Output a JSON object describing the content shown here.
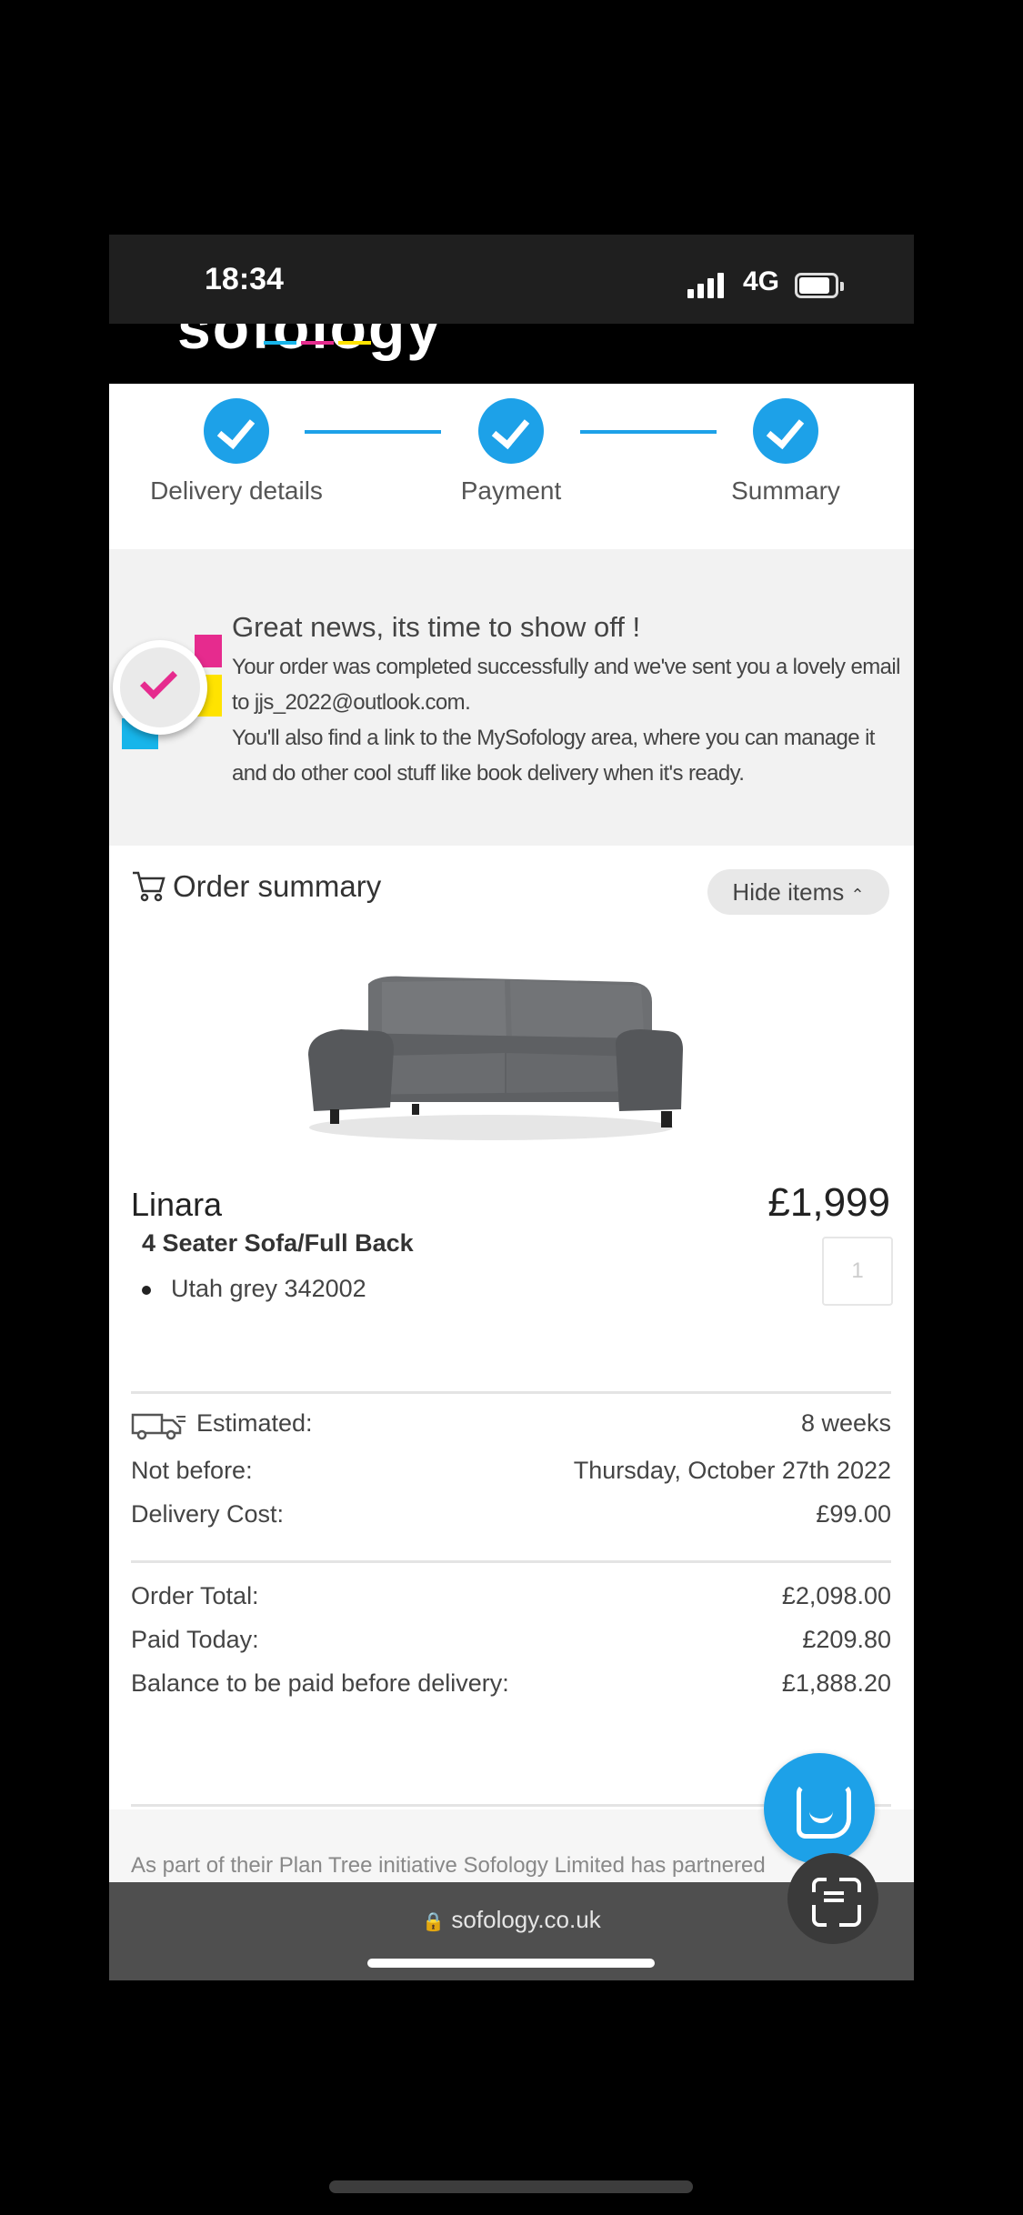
{
  "status_bar": {
    "time": "18:34",
    "network": "4G"
  },
  "logo": {
    "text": "sofology"
  },
  "steps": [
    {
      "label": "Delivery details"
    },
    {
      "label": "Payment"
    },
    {
      "label": "Summary"
    }
  ],
  "notice": {
    "title": "Great news, its time to show off !",
    "message_1": "Your order was completed successfully and we've sent you a lovely email to",
    "email": "jjs_2022@outlook.com.",
    "message_2": "You'll also find a link to the MySofology area, where you can manage it and do other cool stuff like book delivery when it's ready."
  },
  "order_summary": {
    "title": "Order summary",
    "hide_items_label": "Hide items",
    "product": {
      "name": "Linara",
      "variant": "4 Seater Sofa/Full Back",
      "option": "Utah grey 342002",
      "price": "£1,999",
      "quantity": "1"
    },
    "delivery": {
      "estimated_label": "Estimated:",
      "estimated_value": "8 weeks",
      "not_before_label": "Not before:",
      "not_before_value": "Thursday, October 27th 2022",
      "cost_label": "Delivery Cost:",
      "cost_value": "£99.00"
    },
    "totals": {
      "order_total_label": "Order Total:",
      "order_total_value": "£2,098.00",
      "paid_today_label": "Paid Today:",
      "paid_today_value": "£209.80",
      "balance_label": "Balance to be paid before delivery:",
      "balance_value": "£1,888.20"
    }
  },
  "footer_text": "As part of their Plan Tree initiative Sofology Limited has partnered",
  "browser": {
    "url": "sofology.co.uk"
  },
  "colors": {
    "accent": "#1da1e8",
    "magenta": "#e62b8e",
    "yellow": "#ffe300",
    "cyan": "#17b5ea"
  }
}
